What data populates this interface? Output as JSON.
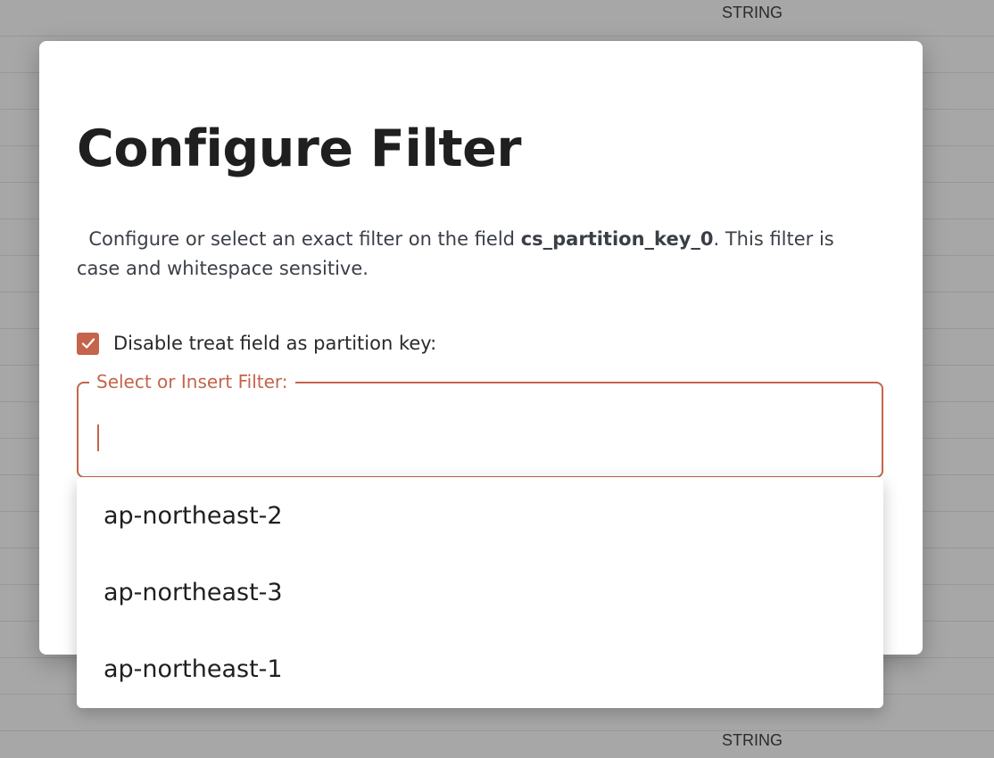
{
  "background": {
    "column_cell_top": "STRING",
    "column_cell_bottom": "STRING"
  },
  "dialog": {
    "title": "Configure Filter",
    "description_prefix": "Configure or select an exact filter on the field ",
    "field_name": "cs_partition_key_0",
    "description_suffix": ". This filter is case and whitespace sensitive.",
    "checkbox": {
      "label": "Disable treat field as partition key:",
      "checked": true
    },
    "filter_input": {
      "legend": "Select or Insert Filter:",
      "value": ""
    }
  },
  "dropdown": {
    "options": [
      "ap-northeast-2",
      "ap-northeast-3",
      "ap-northeast-1"
    ]
  },
  "colors": {
    "accent": "#c4644b",
    "overlay": "#a7a7a7"
  }
}
